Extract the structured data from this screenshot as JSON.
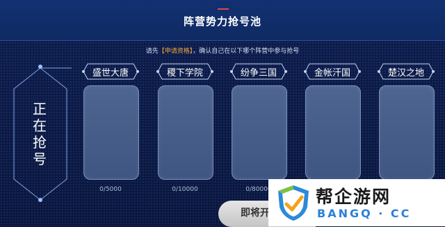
{
  "header": {
    "title": "阵营势力抢号池"
  },
  "notice": {
    "prefix": "请先",
    "link": "【申请资格】",
    "suffix": "，确认自己在以下哪个阵营中参与抢号"
  },
  "status_panel": {
    "chars": [
      "正",
      "在",
      "抢",
      "号"
    ]
  },
  "factions": [
    {
      "name": "盛世大唐",
      "count": "0/5000"
    },
    {
      "name": "稷下学院",
      "count": "0/10000"
    },
    {
      "name": "纷争三国",
      "count": "0/80000"
    },
    {
      "name": "金帐汗国",
      "count": ""
    },
    {
      "name": "楚汉之地",
      "count": ""
    }
  ],
  "soon_button": {
    "label": "即将开"
  },
  "watermark": {
    "brand": "帮企游网",
    "domain": "BANGQ · CC"
  },
  "colors": {
    "header": "#123172",
    "link": "#f0a640",
    "card": "#4e6491",
    "watermark_blue": "#2a7fd8"
  }
}
